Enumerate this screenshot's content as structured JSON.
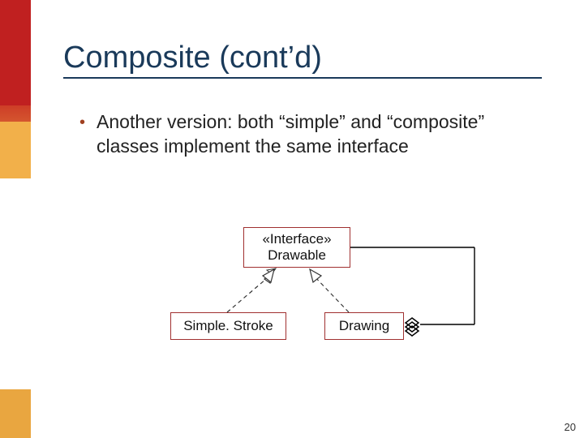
{
  "title": "Composite (cont’d)",
  "bullet": {
    "text": "Another version: both “simple” and “composite” classes implement the same interface"
  },
  "uml": {
    "interface_stereotype": "«Interface»",
    "interface_name": "Drawable",
    "simple_class": "Simple. Stroke",
    "composite_class": "Drawing"
  },
  "page_number": "20",
  "colors": {
    "title": "#1a3a5a",
    "box_border": "#a03030",
    "bullet": "#a04020"
  }
}
